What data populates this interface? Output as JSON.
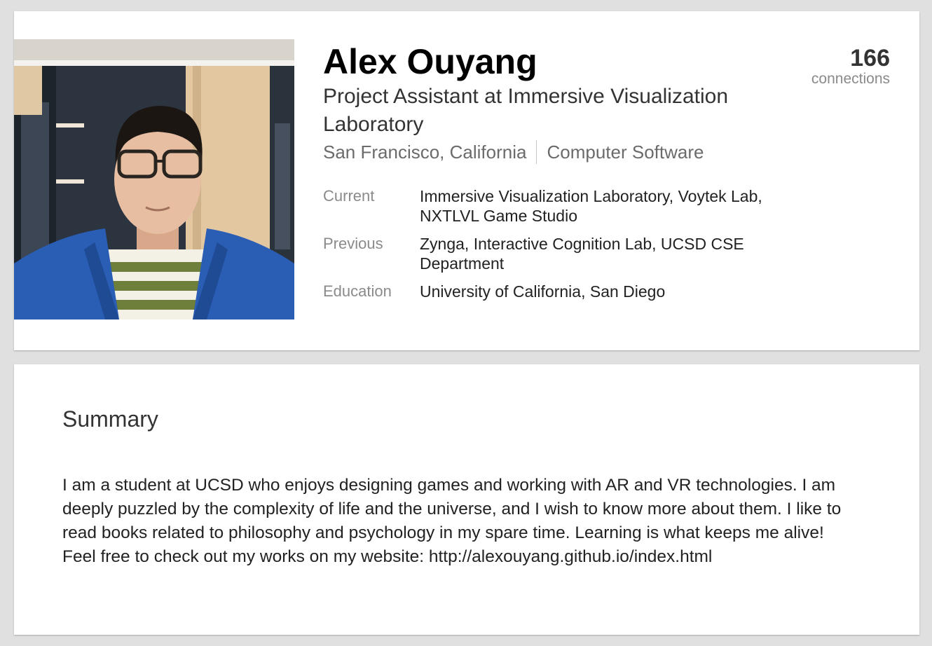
{
  "profile": {
    "name": "Alex Ouyang",
    "headline": "Project Assistant at Immersive Visualization Laboratory",
    "location": "San Francisco, California",
    "industry": "Computer Software",
    "connections_count": "166",
    "connections_label": "connections",
    "photo_icon": "profile-photo"
  },
  "details": [
    {
      "label": "Current",
      "value": "Immersive Visualization Laboratory, Voytek Lab, NXTLVL Game Studio"
    },
    {
      "label": "Previous",
      "value": "Zynga, Interactive Cognition Lab, UCSD CSE Department"
    },
    {
      "label": "Education",
      "value": "University of California, San Diego"
    }
  ],
  "summary": {
    "title": "Summary",
    "text": "I am a student at UCSD who enjoys designing games and working with AR and VR technologies. I am deeply puzzled by the complexity of life and the universe, and I wish to know more about them. I like to read books related to philosophy and psychology in my spare time. Learning is what keeps me alive!\nFeel free to check out my works on my website: http://alexouyang.github.io/index.html"
  },
  "colors": {
    "background": "#e0e0e0",
    "card": "#ffffff",
    "name": "#000000",
    "muted": "#8a8a8a"
  }
}
